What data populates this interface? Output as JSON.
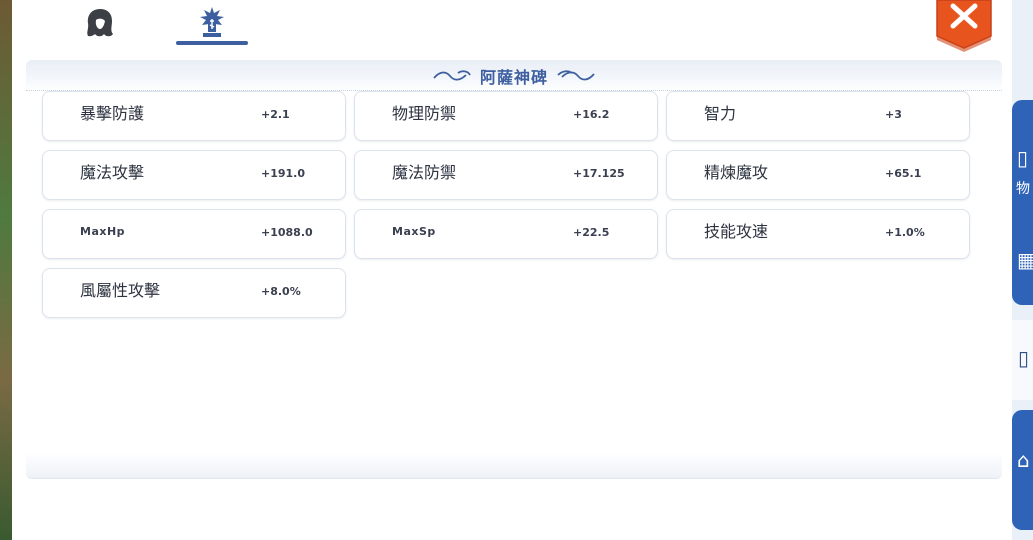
{
  "tabs": [
    {
      "icon": "hero-portrait-icon",
      "selected": false
    },
    {
      "icon": "monument-icon",
      "selected": true
    }
  ],
  "header": {
    "title": "阿薩神碑"
  },
  "stats": [
    {
      "name": "暴擊防護",
      "value": "+2.1"
    },
    {
      "name": "物理防禦",
      "value": "+16.2"
    },
    {
      "name": "智力",
      "value": "+3"
    },
    {
      "name": "魔法攻擊",
      "value": "+191.0"
    },
    {
      "name": "魔法防禦",
      "value": "+17.125"
    },
    {
      "name": "精煉魔攻",
      "value": "+65.1"
    },
    {
      "name": "MaxHp",
      "value": "+1088.0"
    },
    {
      "name": "MaxSp",
      "value": "+22.5"
    },
    {
      "name": "技能攻速",
      "value": "+1.0%"
    },
    {
      "name": "風屬性攻擊",
      "value": "+8.0%"
    }
  ],
  "colors": {
    "accent": "#3d5fa0",
    "close_button": "#e8541e",
    "side_button": "#2e63b8"
  },
  "side": {
    "partial_label": "物"
  }
}
